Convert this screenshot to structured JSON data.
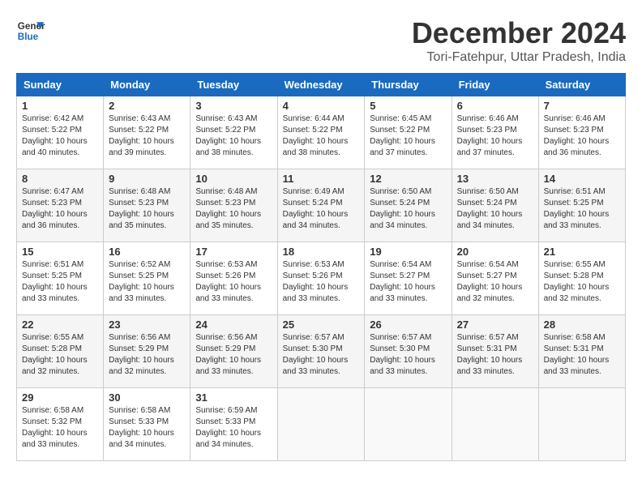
{
  "logo": {
    "line1": "General",
    "line2": "Blue"
  },
  "title": "December 2024",
  "location": "Tori-Fatehpur, Uttar Pradesh, India",
  "days_of_week": [
    "Sunday",
    "Monday",
    "Tuesday",
    "Wednesday",
    "Thursday",
    "Friday",
    "Saturday"
  ],
  "weeks": [
    [
      {
        "day": "1",
        "info": "Sunrise: 6:42 AM\nSunset: 5:22 PM\nDaylight: 10 hours\nand 40 minutes."
      },
      {
        "day": "2",
        "info": "Sunrise: 6:43 AM\nSunset: 5:22 PM\nDaylight: 10 hours\nand 39 minutes."
      },
      {
        "day": "3",
        "info": "Sunrise: 6:43 AM\nSunset: 5:22 PM\nDaylight: 10 hours\nand 38 minutes."
      },
      {
        "day": "4",
        "info": "Sunrise: 6:44 AM\nSunset: 5:22 PM\nDaylight: 10 hours\nand 38 minutes."
      },
      {
        "day": "5",
        "info": "Sunrise: 6:45 AM\nSunset: 5:22 PM\nDaylight: 10 hours\nand 37 minutes."
      },
      {
        "day": "6",
        "info": "Sunrise: 6:46 AM\nSunset: 5:23 PM\nDaylight: 10 hours\nand 37 minutes."
      },
      {
        "day": "7",
        "info": "Sunrise: 6:46 AM\nSunset: 5:23 PM\nDaylight: 10 hours\nand 36 minutes."
      }
    ],
    [
      {
        "day": "8",
        "info": "Sunrise: 6:47 AM\nSunset: 5:23 PM\nDaylight: 10 hours\nand 36 minutes."
      },
      {
        "day": "9",
        "info": "Sunrise: 6:48 AM\nSunset: 5:23 PM\nDaylight: 10 hours\nand 35 minutes."
      },
      {
        "day": "10",
        "info": "Sunrise: 6:48 AM\nSunset: 5:23 PM\nDaylight: 10 hours\nand 35 minutes."
      },
      {
        "day": "11",
        "info": "Sunrise: 6:49 AM\nSunset: 5:24 PM\nDaylight: 10 hours\nand 34 minutes."
      },
      {
        "day": "12",
        "info": "Sunrise: 6:50 AM\nSunset: 5:24 PM\nDaylight: 10 hours\nand 34 minutes."
      },
      {
        "day": "13",
        "info": "Sunrise: 6:50 AM\nSunset: 5:24 PM\nDaylight: 10 hours\nand 34 minutes."
      },
      {
        "day": "14",
        "info": "Sunrise: 6:51 AM\nSunset: 5:25 PM\nDaylight: 10 hours\nand 33 minutes."
      }
    ],
    [
      {
        "day": "15",
        "info": "Sunrise: 6:51 AM\nSunset: 5:25 PM\nDaylight: 10 hours\nand 33 minutes."
      },
      {
        "day": "16",
        "info": "Sunrise: 6:52 AM\nSunset: 5:25 PM\nDaylight: 10 hours\nand 33 minutes."
      },
      {
        "day": "17",
        "info": "Sunrise: 6:53 AM\nSunset: 5:26 PM\nDaylight: 10 hours\nand 33 minutes."
      },
      {
        "day": "18",
        "info": "Sunrise: 6:53 AM\nSunset: 5:26 PM\nDaylight: 10 hours\nand 33 minutes."
      },
      {
        "day": "19",
        "info": "Sunrise: 6:54 AM\nSunset: 5:27 PM\nDaylight: 10 hours\nand 33 minutes."
      },
      {
        "day": "20",
        "info": "Sunrise: 6:54 AM\nSunset: 5:27 PM\nDaylight: 10 hours\nand 32 minutes."
      },
      {
        "day": "21",
        "info": "Sunrise: 6:55 AM\nSunset: 5:28 PM\nDaylight: 10 hours\nand 32 minutes."
      }
    ],
    [
      {
        "day": "22",
        "info": "Sunrise: 6:55 AM\nSunset: 5:28 PM\nDaylight: 10 hours\nand 32 minutes."
      },
      {
        "day": "23",
        "info": "Sunrise: 6:56 AM\nSunset: 5:29 PM\nDaylight: 10 hours\nand 32 minutes."
      },
      {
        "day": "24",
        "info": "Sunrise: 6:56 AM\nSunset: 5:29 PM\nDaylight: 10 hours\nand 33 minutes."
      },
      {
        "day": "25",
        "info": "Sunrise: 6:57 AM\nSunset: 5:30 PM\nDaylight: 10 hours\nand 33 minutes."
      },
      {
        "day": "26",
        "info": "Sunrise: 6:57 AM\nSunset: 5:30 PM\nDaylight: 10 hours\nand 33 minutes."
      },
      {
        "day": "27",
        "info": "Sunrise: 6:57 AM\nSunset: 5:31 PM\nDaylight: 10 hours\nand 33 minutes."
      },
      {
        "day": "28",
        "info": "Sunrise: 6:58 AM\nSunset: 5:31 PM\nDaylight: 10 hours\nand 33 minutes."
      }
    ],
    [
      {
        "day": "29",
        "info": "Sunrise: 6:58 AM\nSunset: 5:32 PM\nDaylight: 10 hours\nand 33 minutes."
      },
      {
        "day": "30",
        "info": "Sunrise: 6:58 AM\nSunset: 5:33 PM\nDaylight: 10 hours\nand 34 minutes."
      },
      {
        "day": "31",
        "info": "Sunrise: 6:59 AM\nSunset: 5:33 PM\nDaylight: 10 hours\nand 34 minutes."
      },
      null,
      null,
      null,
      null
    ]
  ]
}
